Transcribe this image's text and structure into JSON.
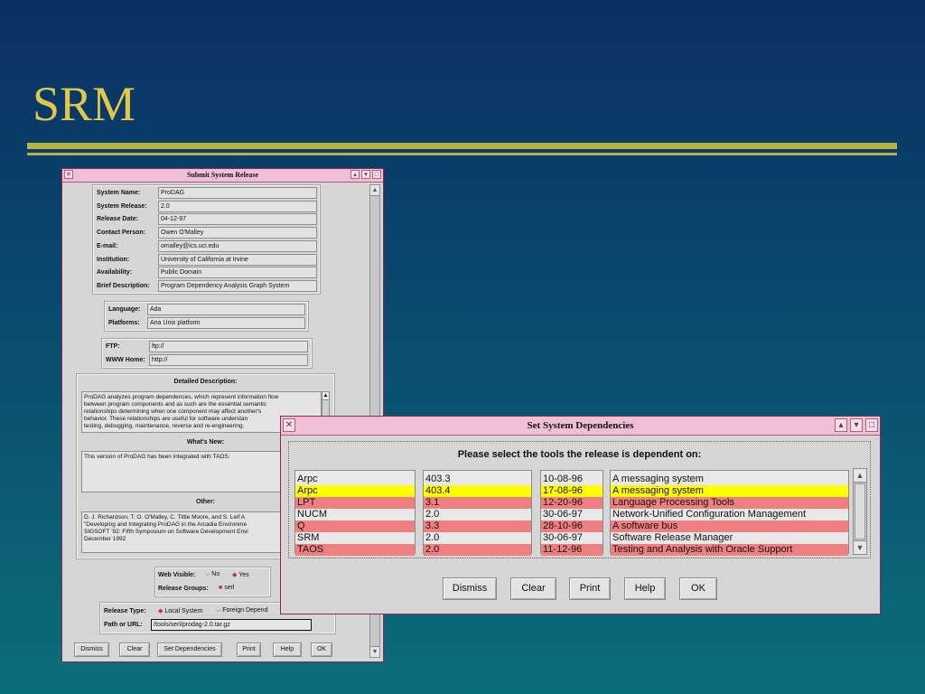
{
  "slide": {
    "title": "SRM"
  },
  "submit_window": {
    "title": "Submit System Release",
    "fields": [
      {
        "label": "System Name:",
        "value": "ProDAG"
      },
      {
        "label": "System Release:",
        "value": "2.0"
      },
      {
        "label": "Release Date:",
        "value": "04-12-97"
      },
      {
        "label": "Contact Person:",
        "value": "Owen O'Malley"
      },
      {
        "label": "E-mail:",
        "value": "omalley@ics.uci.edu"
      },
      {
        "label": "Institution:",
        "value": "University of California at Irvine"
      },
      {
        "label": "Availability:",
        "value": "Public Domain"
      },
      {
        "label": "Brief Description:",
        "value": "Program Dependency Analysis Graph System"
      }
    ],
    "lang_fields": [
      {
        "label": "Language:",
        "value": "Ada"
      },
      {
        "label": "Platforms:",
        "value": "Ana Unix platform"
      }
    ],
    "net_fields": [
      {
        "label": "FTP:",
        "value": "ftp://"
      },
      {
        "label": "WWW Home:",
        "value": "http://"
      }
    ],
    "detailed_title": "Detailed Description:",
    "detailed_lines": [
      "ProDAG analyzes program dependences, which represent information flow",
      "between program components and as such are the essential semantic",
      "relationships determining when one component may affect another's",
      "behavior. These relationships are useful for software understan",
      "testing, debugging, maintenance, reverse and re-engineering."
    ],
    "whats_new_title": "What's New:",
    "whats_new_lines": [
      "This version of ProDAG has been integrated with TAOS."
    ],
    "other_title": "Other:",
    "other_lines": [
      "D. J. Richardson, T. O. O'Malley, C. Tittle Moore, and S. Leif A",
      "\"Developing and Integrating ProDAG in the Arcadia Environme",
      "SIGSOFT '92: Fifth Symposium on Software Development Envi",
      "December 1992"
    ],
    "web_visible_label": "Web Visible:",
    "web_visible_no": "No",
    "web_visible_yes": "Yes",
    "release_groups_label": "Release Groups:",
    "release_groups_value": "serl",
    "release_type_label": "Release Type:",
    "release_type_local": "Local System",
    "release_type_foreign": "Foreign Depend",
    "path_label": "Path or URL:",
    "path_value": "/tools/serl/prodag-2.0.tar.gz",
    "buttons": [
      "Dismiss",
      "Clear",
      "Set Dependencies",
      "Print",
      "Help",
      "OK"
    ]
  },
  "deps_window": {
    "title": "Set System Dependencies",
    "prompt": "Please select the tools the release is dependent on:",
    "rows": [
      {
        "name": "Arpc",
        "version": "403.3",
        "date": "10-08-96",
        "desc": "A messaging system",
        "highlight": "none"
      },
      {
        "name": "Arpc",
        "version": "403.4",
        "date": "17-08-96",
        "desc": "A messaging system",
        "highlight": "yellow"
      },
      {
        "name": "LPT",
        "version": "3.1",
        "date": "12-20-96",
        "desc": "Language Processing Tools",
        "highlight": "red"
      },
      {
        "name": "NUCM",
        "version": "2.0",
        "date": "30-06-97",
        "desc": "Network-Unified Configuration Management",
        "highlight": "none"
      },
      {
        "name": "Q",
        "version": "3.3",
        "date": "28-10-96",
        "desc": "A software bus",
        "highlight": "red"
      },
      {
        "name": "SRM",
        "version": "2.0",
        "date": "30-06-97",
        "desc": "Software Release Manager",
        "highlight": "none"
      },
      {
        "name": "TAOS",
        "version": "2.0",
        "date": "11-12-96",
        "desc": "Testing and Analysis with Oracle Support",
        "highlight": "red"
      }
    ],
    "buttons": [
      "Dismiss",
      "Clear",
      "Print",
      "Help",
      "OK"
    ]
  },
  "colors": {
    "yellow": "#ffff00",
    "red": "#f08080",
    "title_gold": "#e0c84b"
  }
}
